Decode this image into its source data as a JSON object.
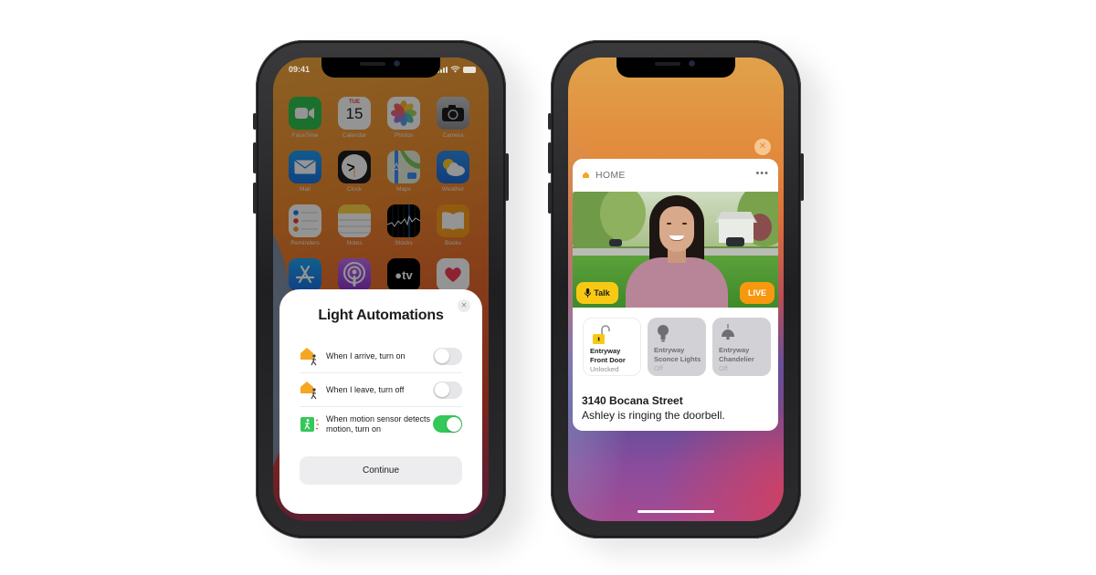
{
  "left_phone": {
    "status_bar": {
      "time": "09:41"
    },
    "home_screen": {
      "apps": [
        {
          "name": "FaceTime",
          "icon": "facetime-icon"
        },
        {
          "name": "Calendar",
          "icon": "calendar-icon",
          "day": "TUE",
          "date": "15"
        },
        {
          "name": "Photos",
          "icon": "photos-icon"
        },
        {
          "name": "Camera",
          "icon": "camera-icon"
        },
        {
          "name": "Mail",
          "icon": "mail-icon"
        },
        {
          "name": "Clock",
          "icon": "clock-icon"
        },
        {
          "name": "Maps",
          "icon": "maps-icon"
        },
        {
          "name": "Weather",
          "icon": "weather-icon"
        },
        {
          "name": "Reminders",
          "icon": "reminders-icon"
        },
        {
          "name": "Notes",
          "icon": "notes-icon"
        },
        {
          "name": "Stocks",
          "icon": "stocks-icon"
        },
        {
          "name": "Books",
          "icon": "books-icon"
        },
        {
          "name": "App Store",
          "icon": "app-store-icon"
        },
        {
          "name": "Podcasts",
          "icon": "podcasts-icon"
        },
        {
          "name": "TV",
          "icon": "apple-tv-icon",
          "glyph": "tv"
        },
        {
          "name": "Health",
          "icon": "health-icon"
        }
      ]
    },
    "modal": {
      "title": "Light Automations",
      "close_glyph": "✕",
      "automations": [
        {
          "label": "When I arrive, turn on",
          "icon": "arrive-home-icon",
          "enabled": false
        },
        {
          "label": "When I leave, turn off",
          "icon": "leave-home-icon",
          "enabled": false
        },
        {
          "label": "When motion sensor detects motion, turn on",
          "icon": "motion-sensor-icon",
          "enabled": true
        }
      ],
      "continue_label": "Continue"
    }
  },
  "right_phone": {
    "notification": {
      "close_glyph": "✕",
      "app_name": "HOME",
      "more_glyph": "•••",
      "camera": {
        "talk_label": "Talk",
        "live_label": "LIVE"
      },
      "accessories": [
        {
          "name_line1": "Entryway",
          "name_line2": "Front Door",
          "state": "Unlocked",
          "icon": "unlocked-lock-icon",
          "active": true
        },
        {
          "name_line1": "Entryway",
          "name_line2": "Sconce Lights",
          "state": "Off",
          "icon": "light-bulb-icon",
          "active": false
        },
        {
          "name_line1": "Entryway",
          "name_line2": "Chandelier",
          "state": "Off",
          "icon": "chandelier-icon",
          "active": false
        }
      ],
      "title": "3140 Bocana Street",
      "body": "Ashley is ringing the doorbell."
    }
  },
  "colors": {
    "toggle_on": "#34c759",
    "toggle_off": "#e5e5ea",
    "talk_button": "#f8c914",
    "live_button": "#f7980f",
    "home_accent": "#f5a623"
  }
}
